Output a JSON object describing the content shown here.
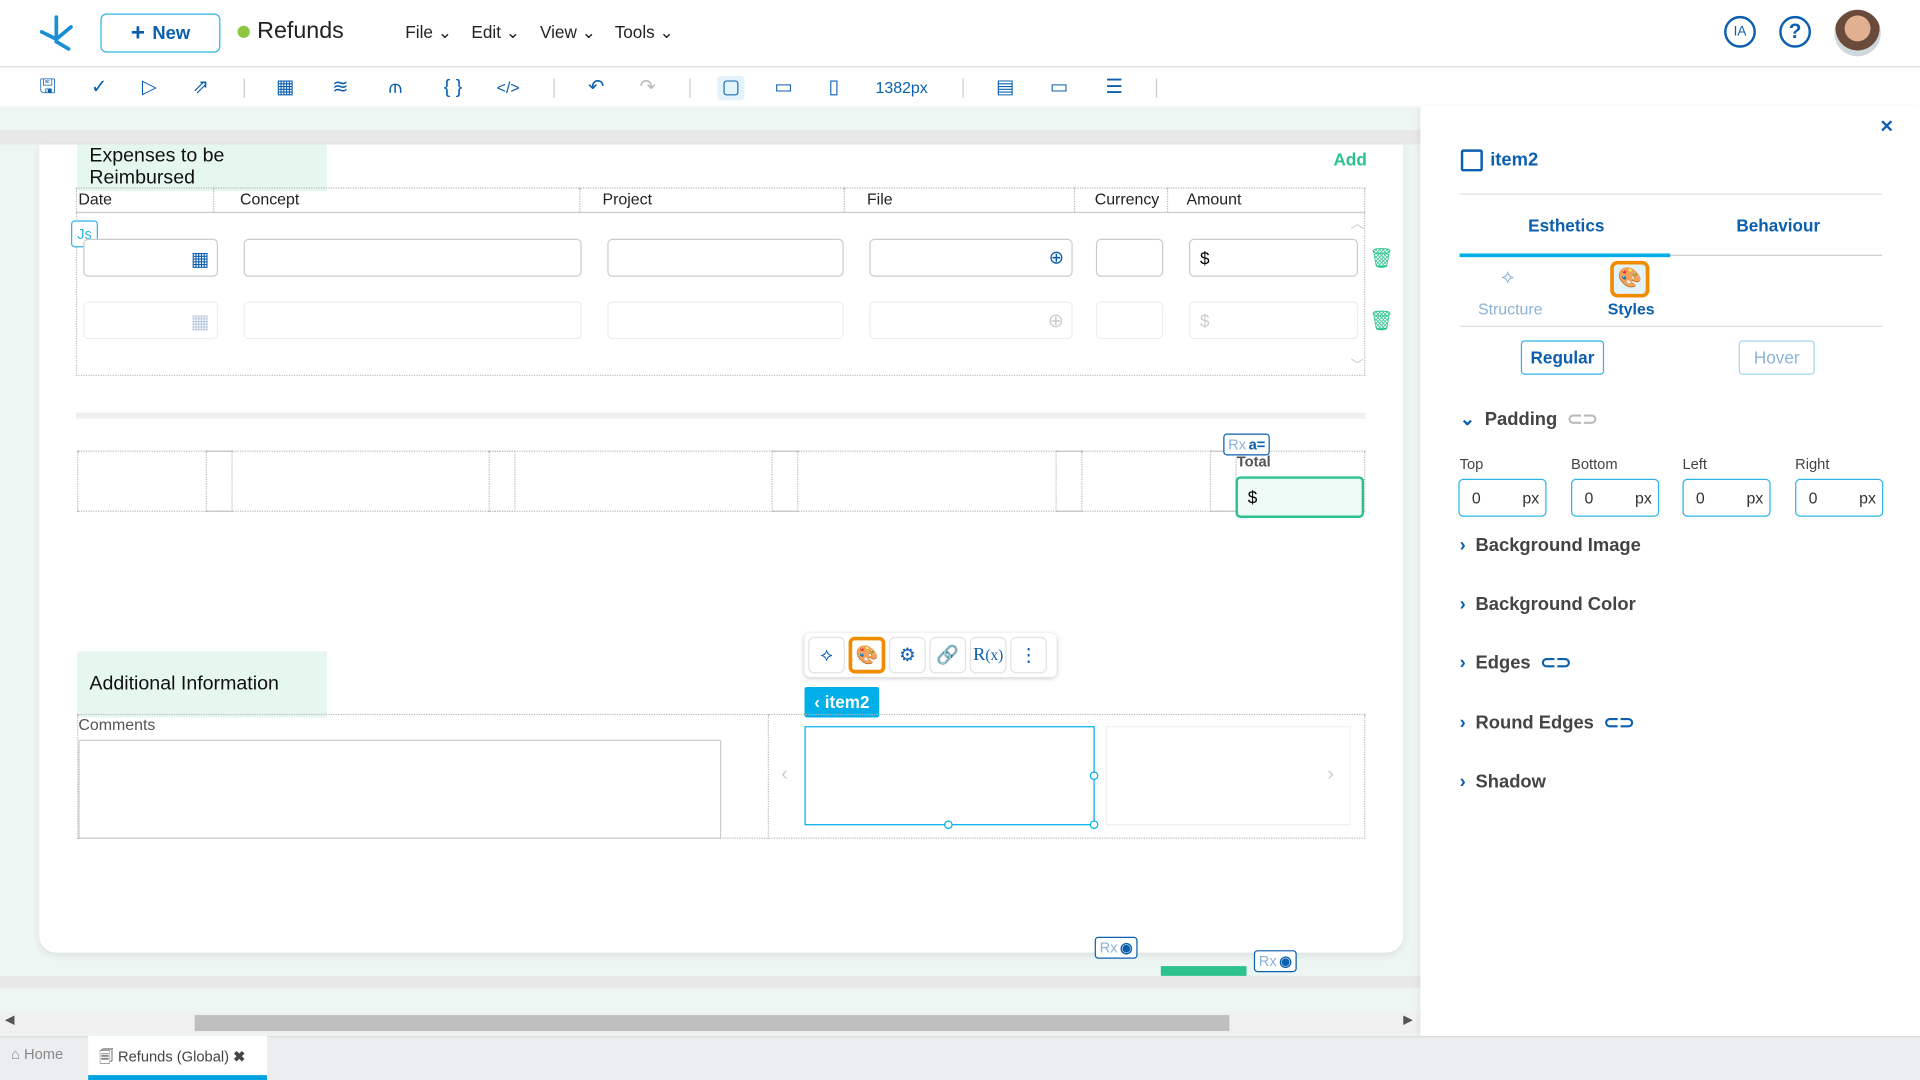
{
  "header": {
    "new_label": "New",
    "app_title": "Refunds",
    "status_color": "#8dc63f",
    "menus": [
      "File",
      "Edit",
      "View",
      "Tools"
    ],
    "ia_label": "IA"
  },
  "toolbar": {
    "icons": [
      "save-icon",
      "check-icon",
      "play-icon",
      "export-icon",
      "components-icon",
      "layers-icon",
      "flow-icon",
      "braces-icon",
      "code-icon",
      "undo-icon",
      "redo-icon",
      "desktop-icon",
      "tablet-icon",
      "mobile-icon",
      "layout-icon",
      "window-icon",
      "align-icon"
    ],
    "width_value": "1382px"
  },
  "expenses": {
    "title": "Expenses to be Reimbursed",
    "add_label": "Add",
    "js_badge": "Js",
    "columns": [
      "Date",
      "Concept",
      "Project",
      "File",
      "Currency",
      "Amount"
    ],
    "currency_symbol": "$",
    "total_label": "Total",
    "total_symbol": "$",
    "rx_label": "Rx"
  },
  "additional": {
    "title": "Additional Information",
    "comments_label": "Comments",
    "item_tag": "item2"
  },
  "panel": {
    "item_name": "item2",
    "tabs": [
      "Esthetics",
      "Behaviour"
    ],
    "active_tab": "Esthetics",
    "subtabs": [
      "Structure",
      "Styles"
    ],
    "active_subtab": "Styles",
    "states": [
      "Regular",
      "Hover"
    ],
    "padding_title": "Padding",
    "padding_fields": [
      {
        "label": "Top",
        "value": "0",
        "unit": "px"
      },
      {
        "label": "Bottom",
        "value": "0",
        "unit": "px"
      },
      {
        "label": "Left",
        "value": "0",
        "unit": "px"
      },
      {
        "label": "Right",
        "value": "0",
        "unit": "px"
      }
    ],
    "sections": [
      "Background Image",
      "Background Color",
      "Edges",
      "Round Edges",
      "Shadow"
    ]
  },
  "bottom_tabs": [
    {
      "label": "Home"
    },
    {
      "label": "Refunds (Global)",
      "active": true
    }
  ],
  "colors": {
    "accent": "#0b5fae",
    "cyan": "#00aee8",
    "green": "#2cc28b",
    "orange": "#f08c00"
  }
}
